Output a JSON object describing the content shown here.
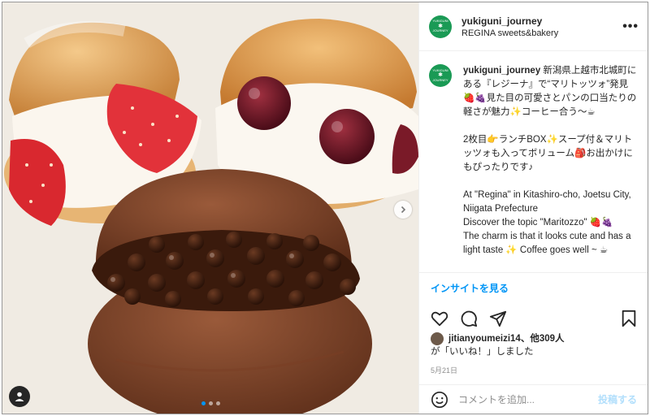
{
  "post": {
    "account": {
      "username": "yukiguni_journey",
      "location": "REGINA sweets&bakery",
      "logo_top": "YUKIGUNI",
      "logo_bottom": "JOURNEY"
    },
    "caption": {
      "username": "yukiguni_journey",
      "paragraph1": "新潟県上越市北城町にある『レジーナ』で“マリトッツォ”発見🍓🍇見た目の可愛さとパンの口当たりの軽さが魅力✨コーヒー合う〜☕",
      "paragraph2": "2枚目👉ランチBOX✨スープ付＆マリトッツォも入ってボリューム🎒お出かけにもぴったりです♪",
      "paragraph3_line1": "At \"Regina\" in Kitashiro-cho, Joetsu City, Niigata Prefecture",
      "paragraph3_line2": "Discover the topic \"Maritozzo\" 🍓🍇",
      "paragraph3_line3": "The charm is that it looks cute and has a light taste ✨ Coffee goes well ~ ☕"
    },
    "insights_label": "インサイトを見る",
    "likes": {
      "liker": "jitianyoumeizi14",
      "others": "、他309人",
      "line2": "が「いいね！」しました"
    },
    "date": "5月21日",
    "comment_placeholder": "コメントを追加...",
    "post_button": "投稿する",
    "carousel": {
      "count": 3,
      "active_index": 0
    },
    "accent_color": "#0095f6",
    "brand_color": "#1a9a55"
  },
  "icons": [
    "more-icon",
    "user-tag-icon",
    "chevron-right-icon",
    "heart-icon",
    "comment-icon",
    "share-icon",
    "bookmark-icon",
    "emoji-icon"
  ]
}
